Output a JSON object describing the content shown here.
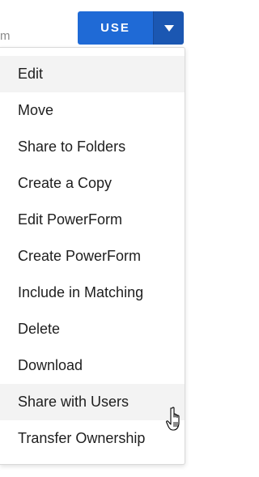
{
  "background_fragment": {
    "text": "m"
  },
  "use_button": {
    "label": "USE"
  },
  "menu": {
    "items": [
      {
        "label": "Edit",
        "highlighted": true
      },
      {
        "label": "Move",
        "highlighted": false
      },
      {
        "label": "Share to Folders",
        "highlighted": false
      },
      {
        "label": "Create a Copy",
        "highlighted": false
      },
      {
        "label": "Edit PowerForm",
        "highlighted": false
      },
      {
        "label": "Create PowerForm",
        "highlighted": false
      },
      {
        "label": "Include in Matching",
        "highlighted": false
      },
      {
        "label": "Delete",
        "highlighted": false
      },
      {
        "label": "Download",
        "highlighted": false
      },
      {
        "label": "Share with Users",
        "highlighted": true
      },
      {
        "label": "Transfer Ownership",
        "highlighted": false
      }
    ]
  },
  "colors": {
    "primary_button": "#1f6ad6",
    "caret_button": "#1b57b2",
    "menu_highlight": "#f3f3f3"
  },
  "icons": {
    "caret": "chevron-down-icon",
    "cursor": "hand-pointer-cursor-icon"
  }
}
